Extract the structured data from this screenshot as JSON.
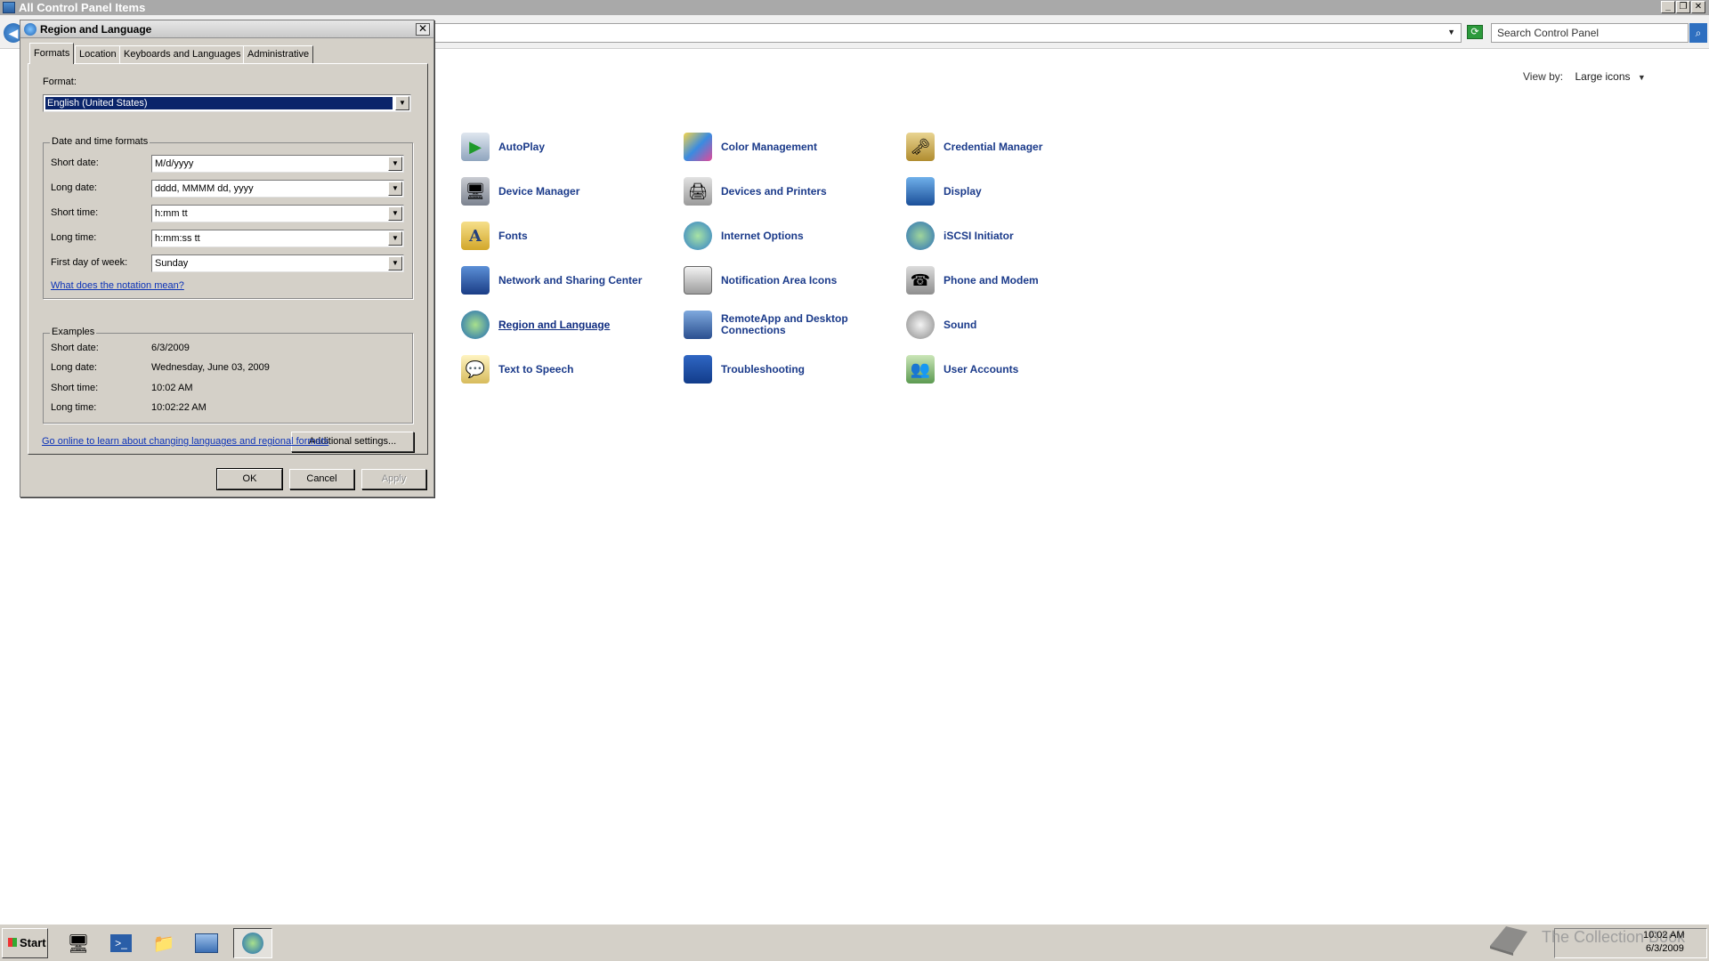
{
  "window": {
    "title": "All Control Panel Items",
    "search_placeholder": "Search Control Panel",
    "view_by_label": "View by:",
    "view_by_value": "Large icons"
  },
  "items": [
    {
      "label": "AutoPlay",
      "icon": "autoplay-icon",
      "link": false
    },
    {
      "label": "Color Management",
      "icon": "color-management-icon",
      "link": false
    },
    {
      "label": "Credential Manager",
      "icon": "credential-manager-icon",
      "link": false
    },
    {
      "label": "Device Manager",
      "icon": "device-manager-icon",
      "link": false
    },
    {
      "label": "Devices and Printers",
      "icon": "devices-printers-icon",
      "link": false
    },
    {
      "label": "Display",
      "icon": "display-icon",
      "link": false
    },
    {
      "label": "Fonts",
      "icon": "fonts-icon",
      "link": false
    },
    {
      "label": "Internet Options",
      "icon": "internet-options-icon",
      "link": false
    },
    {
      "label": "iSCSI Initiator",
      "icon": "iscsi-initiator-icon",
      "link": false
    },
    {
      "label": "Network and Sharing Center",
      "icon": "network-sharing-icon",
      "link": false
    },
    {
      "label": "Notification Area Icons",
      "icon": "notification-area-icon",
      "link": false
    },
    {
      "label": "Phone and Modem",
      "icon": "phone-modem-icon",
      "link": false
    },
    {
      "label": "Region and Language",
      "icon": "region-language-icon",
      "link": true
    },
    {
      "label": "RemoteApp and Desktop",
      "label2": "Connections",
      "icon": "remoteapp-icon",
      "link": false
    },
    {
      "label": "Sound",
      "icon": "sound-icon",
      "link": false
    },
    {
      "label": "Text to Speech",
      "icon": "text-to-speech-icon",
      "link": false
    },
    {
      "label": "Troubleshooting",
      "icon": "troubleshooting-icon",
      "link": false
    },
    {
      "label": "User Accounts",
      "icon": "user-accounts-icon",
      "link": false
    }
  ],
  "dialog": {
    "title": "Region and Language",
    "close": "✕",
    "tabs": [
      "Formats",
      "Location",
      "Keyboards and Languages",
      "Administrative"
    ],
    "format_label": "Format:",
    "format_value": "English (United States)",
    "datetime_group": "Date and time formats",
    "fields": [
      {
        "label": "Short date:",
        "value": "M/d/yyyy"
      },
      {
        "label": "Long date:",
        "value": "dddd, MMMM dd, yyyy"
      },
      {
        "label": "Short time:",
        "value": "h:mm tt"
      },
      {
        "label": "Long time:",
        "value": "h:mm:ss tt"
      },
      {
        "label": "First day of week:",
        "value": "Sunday"
      }
    ],
    "notation_link": "What does the notation mean?",
    "examples_group": "Examples",
    "examples": [
      {
        "label": "Short date:",
        "value": "6/3/2009"
      },
      {
        "label": "Long date:",
        "value": "Wednesday, June 03, 2009"
      },
      {
        "label": "Short time:",
        "value": "10:02 AM"
      },
      {
        "label": "Long time:",
        "value": "10:02:22 AM"
      }
    ],
    "additional_settings": "Additional settings...",
    "online_link": "Go online to learn about changing languages and regional formats",
    "ok": "OK",
    "cancel": "Cancel",
    "apply": "Apply"
  },
  "taskbar": {
    "start": "Start",
    "clock_time": "10:02 AM",
    "clock_date": "6/3/2009",
    "watermark": "The Collection Book"
  }
}
